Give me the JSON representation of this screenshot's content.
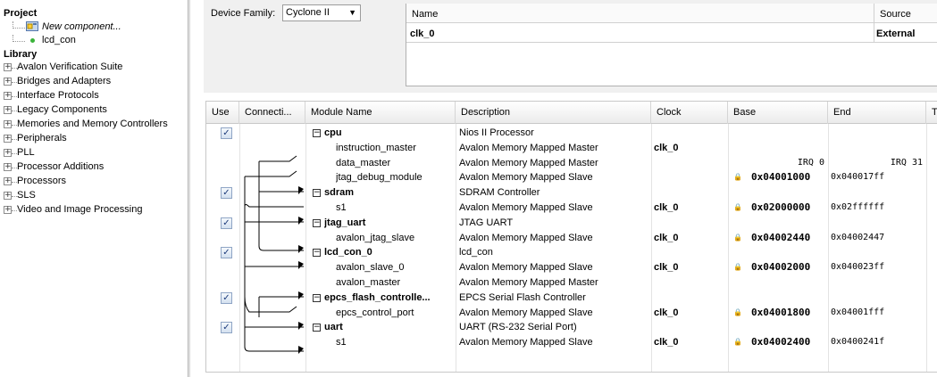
{
  "project": {
    "title": "Project",
    "items": [
      {
        "label": "New component...",
        "icon": "new-component-icon"
      },
      {
        "label": "lcd_con",
        "icon": "green-dot-icon"
      }
    ]
  },
  "library": {
    "title": "Library",
    "items": [
      {
        "label": "Avalon Verification Suite"
      },
      {
        "label": "Bridges and Adapters"
      },
      {
        "label": "Interface Protocols"
      },
      {
        "label": "Legacy Components"
      },
      {
        "label": "Memories and Memory Controllers"
      },
      {
        "label": "Peripherals"
      },
      {
        "label": "PLL"
      },
      {
        "label": "Processor Additions"
      },
      {
        "label": "Processors"
      },
      {
        "label": "SLS"
      },
      {
        "label": "Video and Image Processing"
      }
    ]
  },
  "device": {
    "label": "Device Family:",
    "value": "Cyclone II"
  },
  "clocks": {
    "columns": {
      "name": "Name",
      "source": "Source"
    },
    "rows": [
      {
        "name": "clk_0",
        "source": "External"
      }
    ]
  },
  "grid": {
    "columns": {
      "use": "Use",
      "connections": "Connecti...",
      "module": "Module Name",
      "description": "Description",
      "clock": "Clock",
      "base": "Base",
      "end": "End",
      "tags": "T"
    },
    "rows": [
      {
        "type": "module",
        "use": true,
        "name": "cpu",
        "description": "Nios II Processor",
        "clock": "",
        "base": "",
        "end": ""
      },
      {
        "type": "port",
        "name": "instruction_master",
        "description": "Avalon Memory Mapped Master",
        "clock": "clk_0",
        "base": "",
        "end": ""
      },
      {
        "type": "port",
        "name": "data_master",
        "description": "Avalon Memory Mapped Master",
        "clock": "",
        "base": "IRQ 0",
        "end": "IRQ 31"
      },
      {
        "type": "port",
        "name": "jtag_debug_module",
        "description": "Avalon Memory Mapped Slave",
        "clock": "",
        "base": "0x04001000",
        "end": "0x040017ff"
      },
      {
        "type": "module",
        "use": true,
        "name": "sdram",
        "description": "SDRAM Controller",
        "clock": "",
        "base": "",
        "end": ""
      },
      {
        "type": "port",
        "name": "s1",
        "description": "Avalon Memory Mapped Slave",
        "clock": "clk_0",
        "base": "0x02000000",
        "end": "0x02ffffff"
      },
      {
        "type": "module",
        "use": true,
        "name": "jtag_uart",
        "description": "JTAG UART",
        "clock": "",
        "base": "",
        "end": ""
      },
      {
        "type": "port",
        "name": "avalon_jtag_slave",
        "description": "Avalon Memory Mapped Slave",
        "clock": "clk_0",
        "base": "0x04002440",
        "end": "0x04002447"
      },
      {
        "type": "module",
        "use": true,
        "name": "lcd_con_0",
        "description": "lcd_con",
        "clock": "",
        "base": "",
        "end": ""
      },
      {
        "type": "port",
        "name": "avalon_slave_0",
        "description": "Avalon Memory Mapped Slave",
        "clock": "clk_0",
        "base": "0x04002000",
        "end": "0x040023ff"
      },
      {
        "type": "port",
        "name": "avalon_master",
        "description": "Avalon Memory Mapped Master",
        "clock": "",
        "base": "",
        "end": ""
      },
      {
        "type": "module",
        "use": true,
        "name": "epcs_flash_controlle...",
        "description": "EPCS Serial Flash Controller",
        "clock": "",
        "base": "",
        "end": ""
      },
      {
        "type": "port",
        "name": "epcs_control_port",
        "description": "Avalon Memory Mapped Slave",
        "clock": "clk_0",
        "base": "0x04001800",
        "end": "0x04001fff"
      },
      {
        "type": "module",
        "use": true,
        "name": "uart",
        "description": "UART (RS-232 Serial Port)",
        "clock": "",
        "base": "",
        "end": ""
      },
      {
        "type": "port",
        "name": "s1",
        "description": "Avalon Memory Mapped Slave",
        "clock": "clk_0",
        "base": "0x04002400",
        "end": "0x0400241f"
      }
    ]
  }
}
